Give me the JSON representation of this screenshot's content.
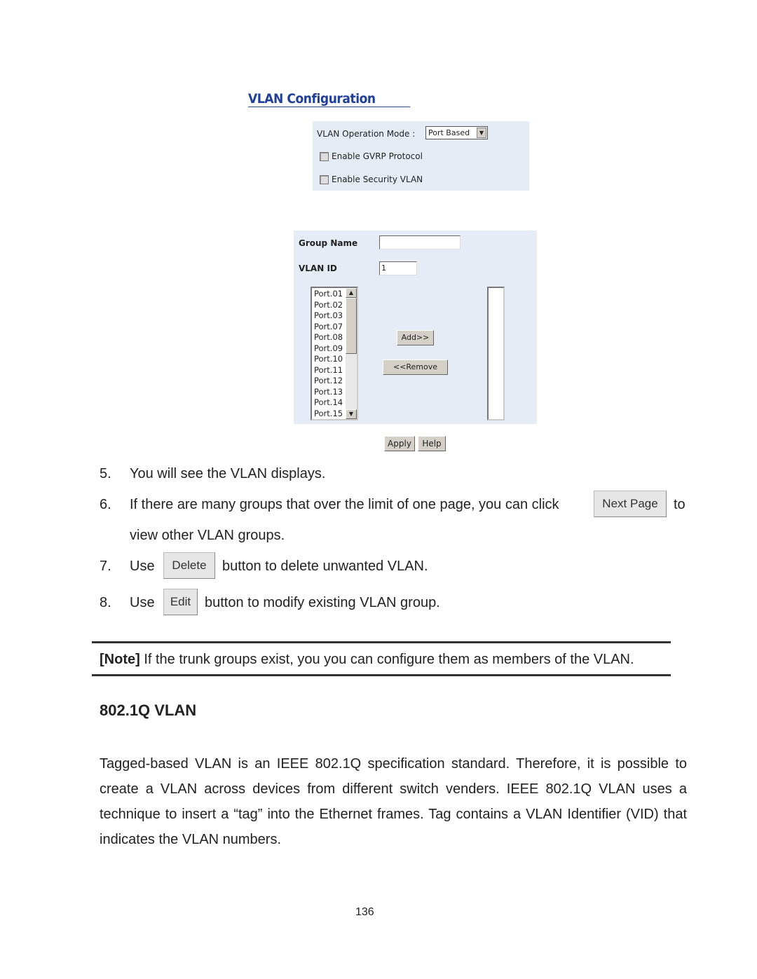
{
  "screenshot": {
    "title": "VLAN Configuration",
    "operation_mode_label": "VLAN Operation Mode :",
    "operation_mode_value": "Port Based",
    "gvrp_label": "Enable GVRP Protocol",
    "gvrp_checked": false,
    "security_label": "Enable Security VLAN",
    "security_checked": false,
    "group_name_label": "Group Name",
    "group_name_value": "",
    "vlan_id_label": "VLAN ID",
    "vlan_id_value": "1",
    "ports": [
      "Port.01",
      "Port.02",
      "Port.03",
      "Port.07",
      "Port.08",
      "Port.09",
      "Port.10",
      "Port.11",
      "Port.12",
      "Port.13",
      "Port.14",
      "Port.15"
    ],
    "add_label": "Add>>",
    "remove_label": "<<Remove",
    "apply_label": "Apply",
    "help_label": "Help"
  },
  "steps": [
    {
      "num": "5.",
      "text": "You will see the VLAN displays."
    },
    {
      "num": "6.",
      "text_before": "If there are many groups that over the limit of one page, you can click",
      "button": "Next Page",
      "text_after": "to",
      "text_cont": "view other VLAN groups."
    },
    {
      "num": "7.",
      "text_before": "Use",
      "button": "Delete",
      "text_after": "button to delete unwanted VLAN."
    },
    {
      "num": "8.",
      "text_before": "Use",
      "button": "Edit",
      "text_after": "button to modify existing VLAN group."
    }
  ],
  "note": {
    "label": "[Note]",
    "text": " If the trunk groups exist, you you can configure them as members of the VLAN."
  },
  "section": {
    "heading": "802.1Q VLAN",
    "paragraph": "Tagged-based VLAN is an IEEE 802.1Q specification standard. Therefore, it is possible to create a VLAN across devices from different switch venders. IEEE 802.1Q VLAN uses a technique to insert a “tag” into the Ethernet frames. Tag contains a VLAN Identifier (VID) that indicates the VLAN numbers."
  },
  "page_number": "136"
}
